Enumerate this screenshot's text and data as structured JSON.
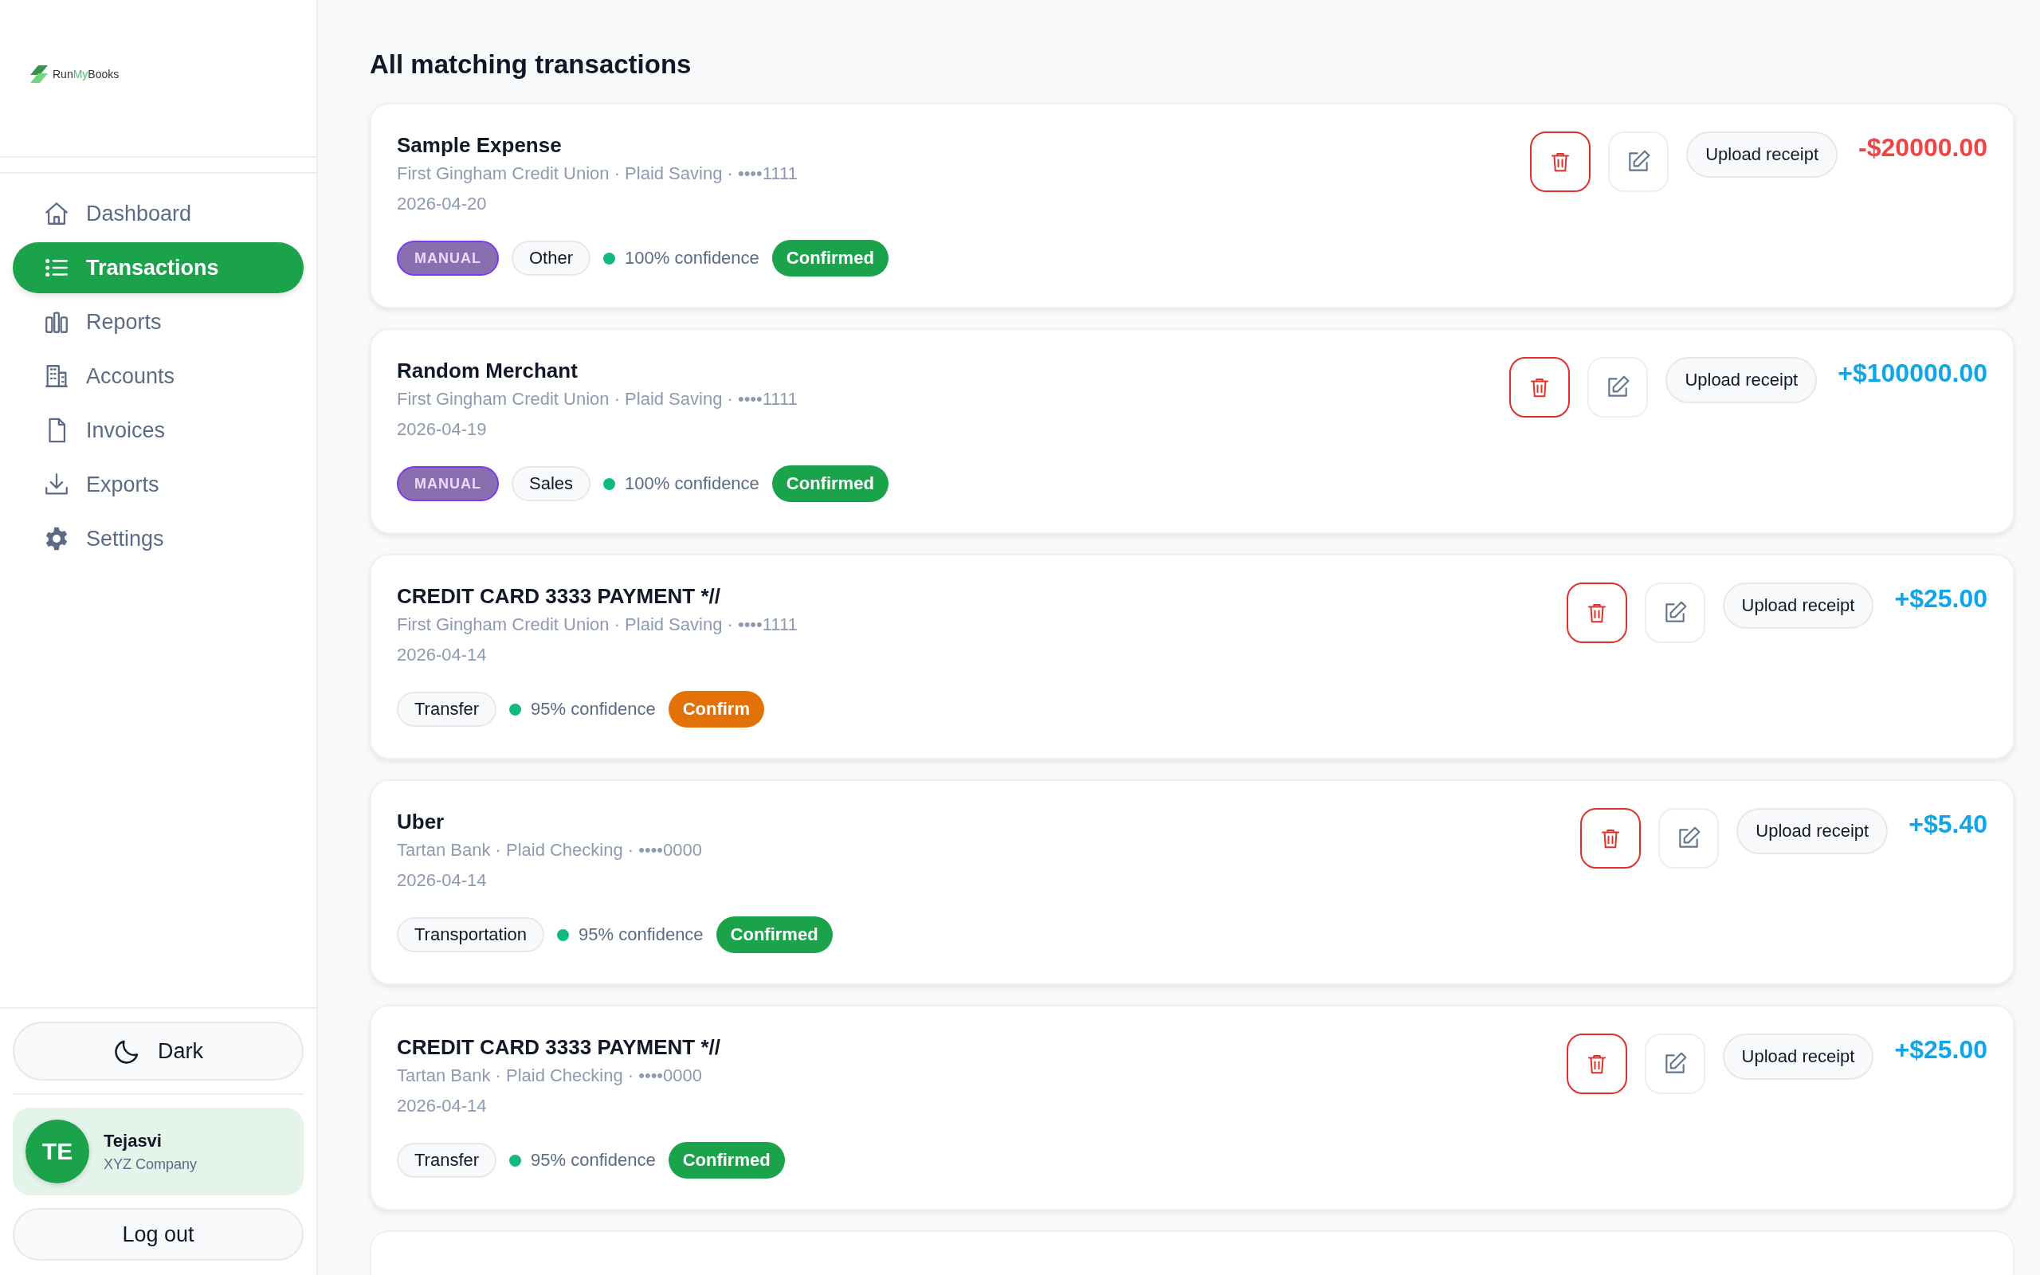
{
  "sidebar": {
    "logo": {
      "start": "Run",
      "accent": "My",
      "end": "Books"
    },
    "nav": [
      {
        "label": "Dashboard",
        "selected": false
      },
      {
        "label": "Transactions",
        "selected": true
      },
      {
        "label": "Reports",
        "selected": false
      },
      {
        "label": "Accounts",
        "selected": false
      },
      {
        "label": "Invoices",
        "selected": false
      },
      {
        "label": "Exports",
        "selected": false
      },
      {
        "label": "Settings",
        "selected": false
      }
    ],
    "theme_button": "Dark",
    "user": {
      "initials": "TE",
      "name": "Tejasvi",
      "company": "XYZ Company"
    },
    "logout_button": "Log out"
  },
  "main": {
    "title": "All matching transactions",
    "transactions": [
      {
        "title": "Sample Expense",
        "account": "First Gingham Credit Union · Plaid Saving · ••••1111",
        "date": "2026-04-20",
        "tags": [
          {
            "kind": "manual",
            "label": "MANUAL"
          },
          {
            "kind": "category",
            "label": "Other"
          }
        ],
        "confidence": "100% confidence",
        "status": "Confirmed",
        "confirmed": true,
        "upload": "Upload receipt",
        "amount": "-$20000.00",
        "kind": "debit"
      },
      {
        "title": "Random Merchant",
        "account": "First Gingham Credit Union · Plaid Saving · ••••1111",
        "date": "2026-04-19",
        "tags": [
          {
            "kind": "manual",
            "label": "MANUAL"
          },
          {
            "kind": "category",
            "label": "Sales"
          }
        ],
        "confidence": "100% confidence",
        "status": "Confirmed",
        "confirmed": true,
        "upload": "Upload receipt",
        "amount": "+$100000.00",
        "kind": "credit"
      },
      {
        "title": "CREDIT CARD 3333 PAYMENT *//",
        "account": "First Gingham Credit Union · Plaid Saving · ••••1111",
        "date": "2026-04-14",
        "tags": [
          {
            "kind": "category",
            "label": "Transfer"
          }
        ],
        "confidence": "95% confidence",
        "status": "Confirm",
        "confirmed": false,
        "upload": "Upload receipt",
        "amount": "+$25.00",
        "kind": "credit"
      },
      {
        "title": "Uber",
        "account": "Tartan Bank · Plaid Checking · ••••0000",
        "date": "2026-04-14",
        "tags": [
          {
            "kind": "category",
            "label": "Transportation"
          }
        ],
        "confidence": "95% confidence",
        "status": "Confirmed",
        "confirmed": true,
        "upload": "Upload receipt",
        "amount": "+$5.40",
        "kind": "credit"
      },
      {
        "title": "CREDIT CARD 3333 PAYMENT *//",
        "account": "Tartan Bank · Plaid Checking · ••••0000",
        "date": "2026-04-14",
        "tags": [
          {
            "kind": "category",
            "label": "Transfer"
          }
        ],
        "confidence": "95% confidence",
        "status": "Confirmed",
        "confirmed": true,
        "upload": "Upload receipt",
        "amount": "+$25.00",
        "kind": "credit"
      },
      {
        "kind": "cut_off"
      }
    ]
  }
}
